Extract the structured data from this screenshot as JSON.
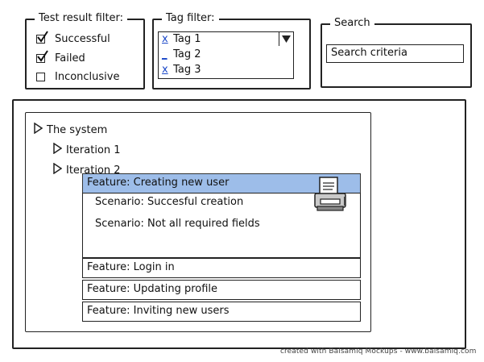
{
  "test_result_filter": {
    "title": "Test result filter:",
    "options": [
      {
        "label": "Successful",
        "checked": true
      },
      {
        "label": "Failed",
        "checked": true
      },
      {
        "label": "Inconclusive",
        "checked": false
      }
    ]
  },
  "tag_filter": {
    "title": "Tag filter:",
    "selected": {
      "mark": "x",
      "label": "Tag 1"
    },
    "options": [
      {
        "mark": "_",
        "label": "Tag 2"
      },
      {
        "mark": "x",
        "label": "Tag 3"
      }
    ]
  },
  "search": {
    "title": "Search",
    "value": "Search criteria"
  },
  "tree": {
    "root": "The system",
    "iterations": [
      "Iteration 1",
      "Iteration 2"
    ],
    "selected_feature": {
      "label": "Feature: Creating new user",
      "scenarios": [
        "Scenario: Succesful creation",
        "Scenario: Not all required fields"
      ],
      "icon": "printer-icon"
    },
    "features": [
      "Feature: Login in",
      "Feature: Updating profile",
      "Feature: Inviting new users"
    ],
    "colors": {
      "selected": "#9dbde9"
    }
  },
  "footer": "created with Balsamiq Mockups - www.balsamiq.com"
}
